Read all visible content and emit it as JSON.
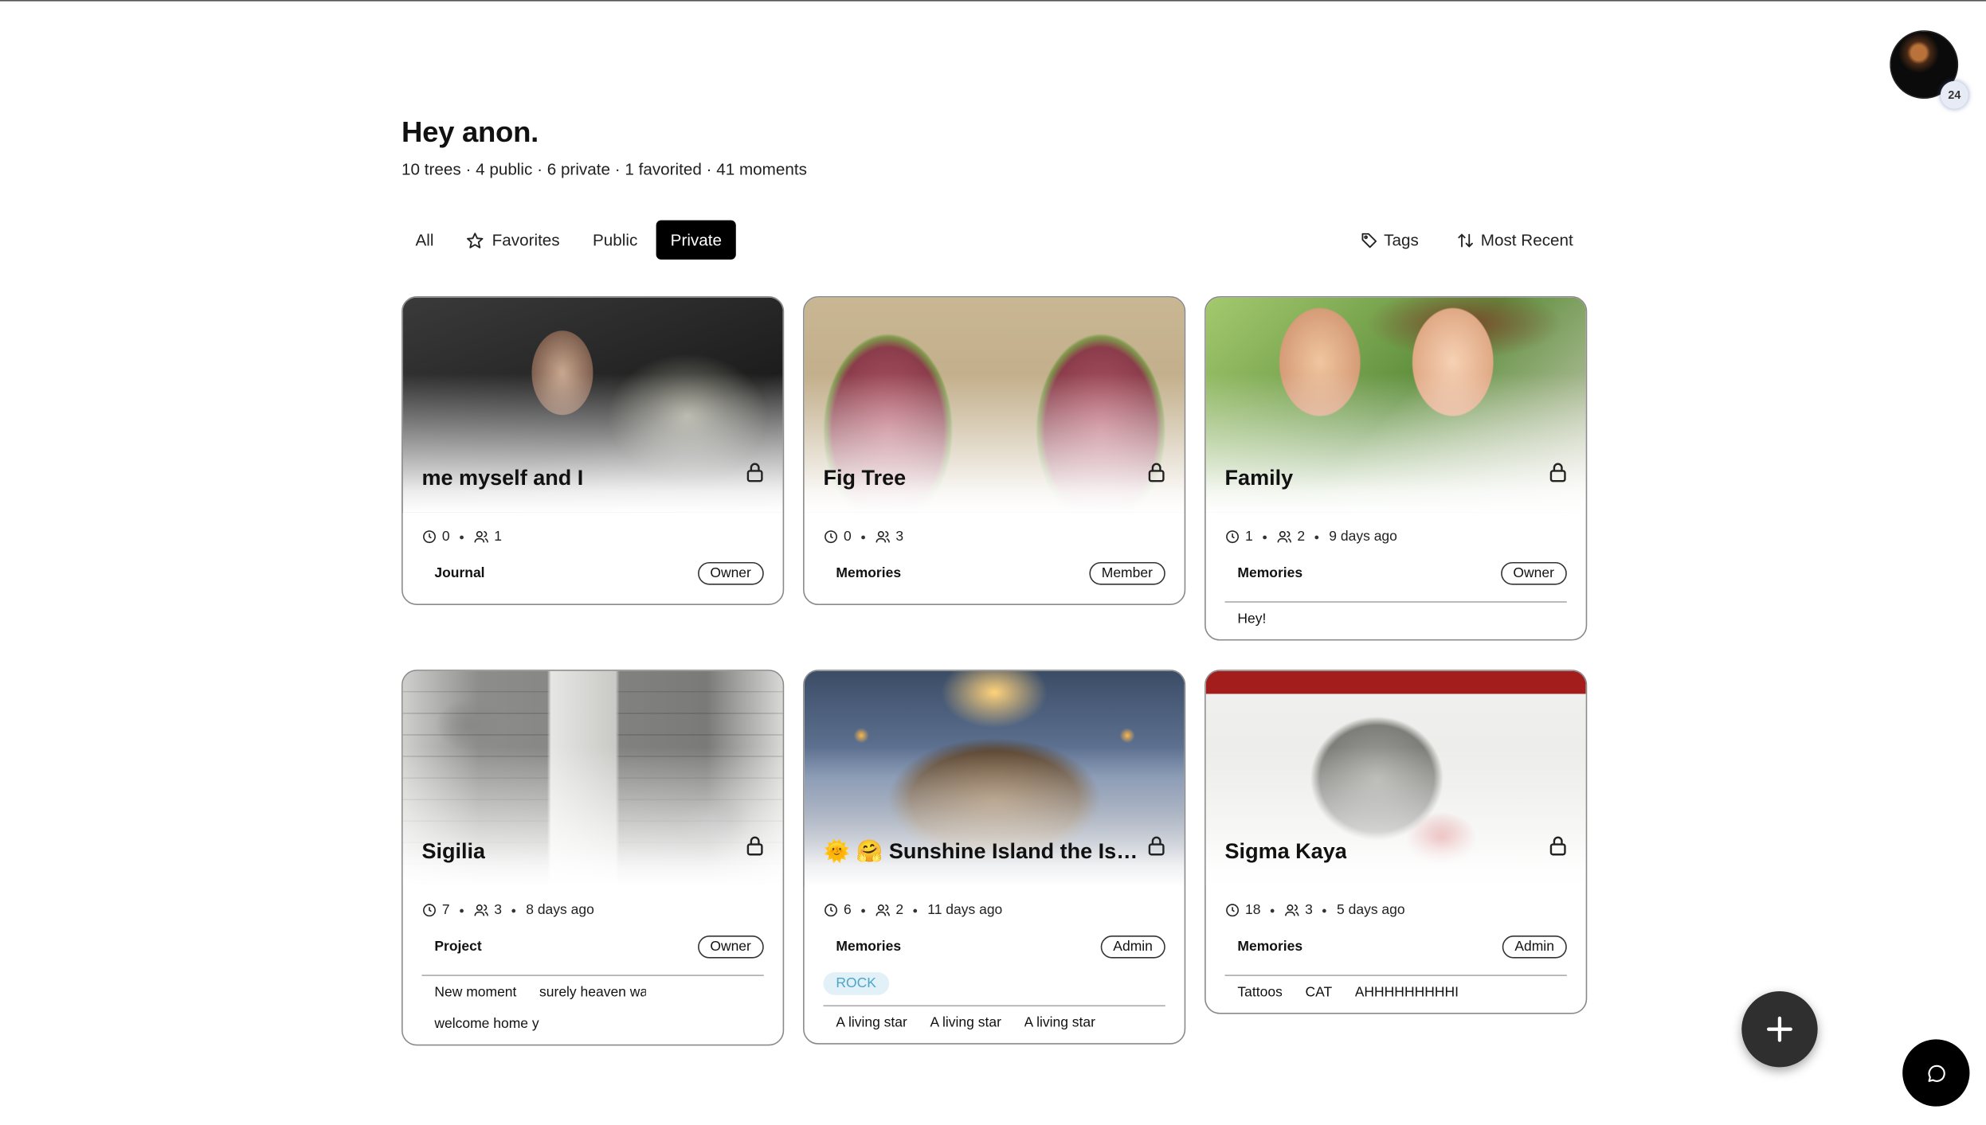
{
  "header": {
    "greeting": "Hey anon.",
    "stats": "10 trees · 4 public · 6 private · 1 favorited · 41 moments",
    "avatar_badge": "24"
  },
  "filters": {
    "all": "All",
    "favorites": "Favorites",
    "public": "Public",
    "private": "Private",
    "active": "Private"
  },
  "sort": {
    "tags": "Tags",
    "order": "Most Recent"
  },
  "cards": [
    {
      "title": "me myself and I",
      "moments": "0",
      "members": "1",
      "age": "",
      "category": "Journal",
      "role": "Owner",
      "tag": "",
      "items": []
    },
    {
      "title": "Fig Tree",
      "moments": "0",
      "members": "3",
      "age": "",
      "category": "Memories",
      "role": "Member",
      "tag": "",
      "items": []
    },
    {
      "title": "Family",
      "moments": "1",
      "members": "2",
      "age": "9 days ago",
      "category": "Memories",
      "role": "Owner",
      "tag": "",
      "items": [
        "Hey!"
      ]
    },
    {
      "title": "Sigilia",
      "moments": "7",
      "members": "3",
      "age": "8 days ago",
      "category": "Project",
      "role": "Owner",
      "tag": "",
      "items": [
        "New moment",
        "surely heaven wa",
        "welcome home y"
      ]
    },
    {
      "title": "🌞 🤗 Sunshine Island the Isle of Light",
      "moments": "6",
      "members": "2",
      "age": "11 days ago",
      "category": "Memories",
      "role": "Admin",
      "tag": "ROCK",
      "items": [
        "A living star",
        "A living star",
        "A living star"
      ]
    },
    {
      "title": "Sigma Kaya",
      "moments": "18",
      "members": "3",
      "age": "5 days ago",
      "category": "Memories",
      "role": "Admin",
      "tag": "",
      "items": [
        "Tattoos",
        "CAT",
        "AHHHHHHHHHI"
      ]
    }
  ],
  "colors": {
    "accent": "#000000",
    "tag_text": "#4aa6c8",
    "tag_bg": "#e2f1f8",
    "fab": "#2f2f2f"
  },
  "icons": {
    "favorites": "star-icon",
    "tags": "tag-icon",
    "sort": "sort-icon",
    "lock": "lock-icon",
    "moments": "clock-icon",
    "members": "users-icon",
    "fab": "plus-icon",
    "chat": "chat-bubble-icon"
  }
}
